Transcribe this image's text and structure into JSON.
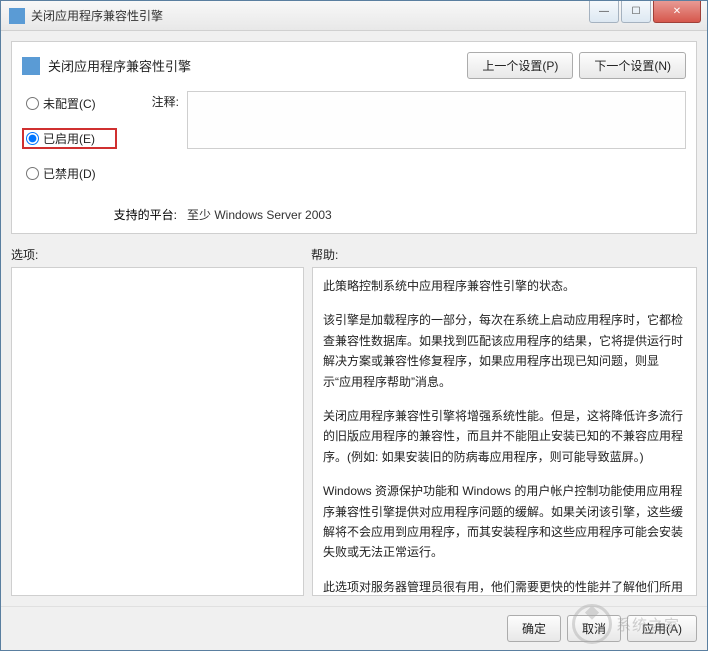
{
  "window": {
    "title": "关闭应用程序兼容性引擎"
  },
  "header": {
    "title": "关闭应用程序兼容性引擎",
    "prev_button": "上一个设置(P)",
    "next_button": "下一个设置(N)"
  },
  "radios": {
    "not_configured": "未配置(C)",
    "enabled": "已启用(E)",
    "disabled": "已禁用(D)"
  },
  "fields": {
    "comment_label": "注释:",
    "platform_label": "支持的平台:",
    "platform_value": "至少 Windows Server 2003"
  },
  "section_labels": {
    "options": "选项:",
    "help": "帮助:"
  },
  "help_text": {
    "p1": "此策略控制系统中应用程序兼容性引擎的状态。",
    "p2": "该引擎是加载程序的一部分，每次在系统上启动应用程序时，它都检查兼容性数据库。如果找到匹配该应用程序的结果，它将提供运行时解决方案或兼容性修复程序，如果应用程序出现已知问题，则显示“应用程序帮助”消息。",
    "p3": "关闭应用程序兼容性引擎将增强系统性能。但是，这将降低许多流行的旧版应用程序的兼容性，而且并不能阻止安装已知的不兼容应用程序。(例如: 如果安装旧的防病毒应用程序，则可能导致蓝屏。)",
    "p4": "Windows 资源保护功能和 Windows 的用户帐户控制功能使用应用程序兼容性引擎提供对应用程序问题的缓解。如果关闭该引擎，这些缓解将不会应用到应用程序，而其安装程序和这些应用程序可能会安装失败或无法正常运行。",
    "p5": "此选项对服务器管理员很有用，他们需要更快的性能并了解他们所用应用程序的兼容性。对于每秒钟可能启动数百次应用程序且加载"
  },
  "footer": {
    "ok": "确定",
    "cancel": "取消",
    "apply": "应用(A)"
  },
  "watermark": {
    "text": "系统之家"
  }
}
